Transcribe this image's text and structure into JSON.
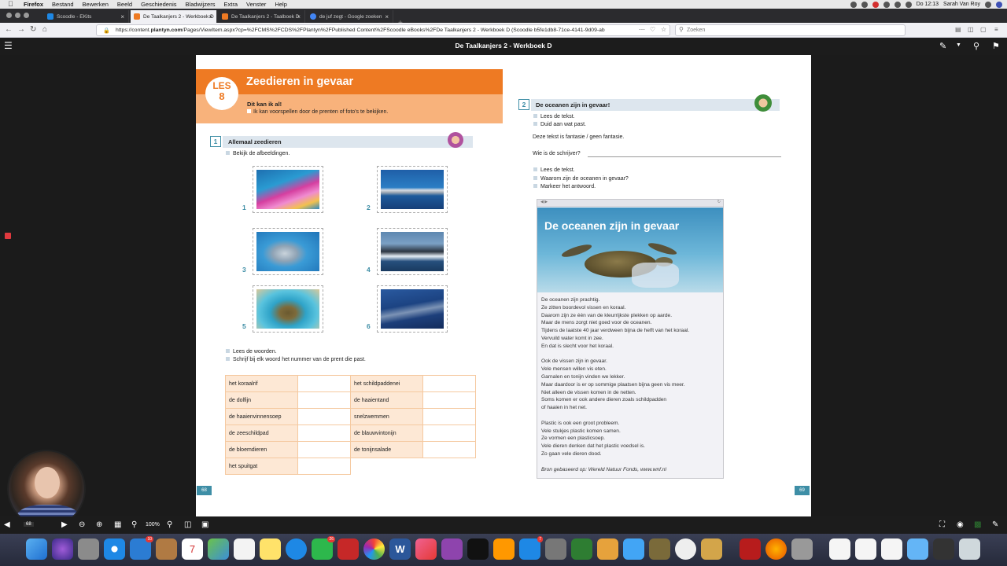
{
  "menubar": {
    "items": [
      "Firefox",
      "Bestand",
      "Bewerken",
      "Beeld",
      "Geschiedenis",
      "Bladwijzers",
      "Extra",
      "Venster",
      "Help"
    ],
    "clock": "Do 12:13",
    "user": "Sarah Van Roy"
  },
  "tabs": [
    {
      "label": "Scoodle - EKits",
      "color": "#1e88e5"
    },
    {
      "label": "De Taalkanjers 2 - Werkboek D",
      "color": "#ee7a23",
      "active": true
    },
    {
      "label": "De Taalkanjers 2 - Taalboek D",
      "color": "#ee7a23"
    },
    {
      "label": "de juf zegt - Google zoeken",
      "color": "#4285f4"
    }
  ],
  "nav": {
    "url_prefix": "https://content.",
    "url_host": "plantyn.com",
    "url_rest": "/Pages/ViewItem.aspx?cp=%2FCMS%2FCDS%2FPlantyn%2FPublished Content%2FScoodle eBooks%2FDe Taalkanjers 2 - Werkboek D (Scoodle b5fe1db8-71ce-4141-9d09-ab",
    "search_placeholder": "Zoeken"
  },
  "viewer": {
    "title": "De Taalkanjers 2 - Werkboek D",
    "zoom": "100%",
    "page_indicator": "68"
  },
  "left_page": {
    "les_label": "LES",
    "les_number": "8",
    "lesson_title": "Zeedieren in gevaar",
    "can_do": "Dit kan ik al!",
    "goal": "Ik kan voorspellen door de prenten of foto's te bekijken.",
    "exercise1": {
      "number": "1",
      "title": "Allemaal zeedieren",
      "instruction": "Bekijk de afbeeldingen.",
      "photos": [
        {
          "num": "1",
          "subject": "coral-reef"
        },
        {
          "num": "2",
          "subject": "shark"
        },
        {
          "num": "3",
          "subject": "dolphin"
        },
        {
          "num": "4",
          "subject": "whale"
        },
        {
          "num": "5",
          "subject": "sea-turtle"
        },
        {
          "num": "6",
          "subject": "tuna-school"
        }
      ],
      "instruction2": "Lees de woorden.",
      "instruction3": "Schrijf bij elk woord het nummer van de prent die past.",
      "words_left": [
        "het koraalrif",
        "de dolfijn",
        "de haaienvinnensoep",
        "de zeeschildpad",
        "de bloemdieren",
        "het spuitgat"
      ],
      "words_right": [
        "het schildpaddenei",
        "de haaientand",
        "snelzwemmen",
        "de blauwvintonijn",
        "de tonijnsalade"
      ]
    },
    "page_number": "68"
  },
  "right_page": {
    "exercise2": {
      "number": "2",
      "title": "De oceanen zijn in gevaar!",
      "step1": "Lees de tekst.",
      "step2": "Duid aan wat past.",
      "statement": "Deze tekst is fantasie / geen fantasie.",
      "question": "Wie is de schrijver?",
      "step3": "Lees de tekst.",
      "step4": "Waarom zijn de oceanen in gevaar?",
      "step5": "Markeer het antwoord."
    },
    "article": {
      "headline": "De oceanen zijn in gevaar",
      "paragraphs": [
        [
          "De oceanen zijn prachtig.",
          "Ze zitten boordevol vissen en koraal.",
          "Daarom zijn ze één van de kleurrijkste plekken op aarde.",
          "Maar de mens zorgt niet goed voor de oceanen.",
          "Tijdens de laatste 40 jaar verdween bijna de helft van het koraal.",
          "Vervuild water komt in zee.",
          "En dat is slecht voor het koraal."
        ],
        [
          "Ook de vissen zijn in gevaar.",
          "Vele mensen willen vis eten.",
          "Garnalen en tonijn vinden we lekker.",
          "Maar daardoor is er op sommige plaatsen bijna geen vis meer.",
          "Niet alleen de vissen komen in de netten.",
          "Soms komen er ook andere dieren zoals schildpadden",
          "of haaien in het net."
        ],
        [
          "Plastic is ook een groot probleem.",
          "Vele stukjes plastic komen samen.",
          "Ze vormen een plasticsoep.",
          "Vele dieren denken dat het plastic voedsel is.",
          "Zo gaan vele dieren dood."
        ]
      ],
      "source": "Bron gebaseerd op: Wereld Natuur Fonds, www.wnf.nl"
    },
    "page_number": "69"
  },
  "dock": {
    "badges": {
      "mail": "10",
      "facetime": "26",
      "appstore": "7"
    },
    "calendar_day": "7"
  }
}
